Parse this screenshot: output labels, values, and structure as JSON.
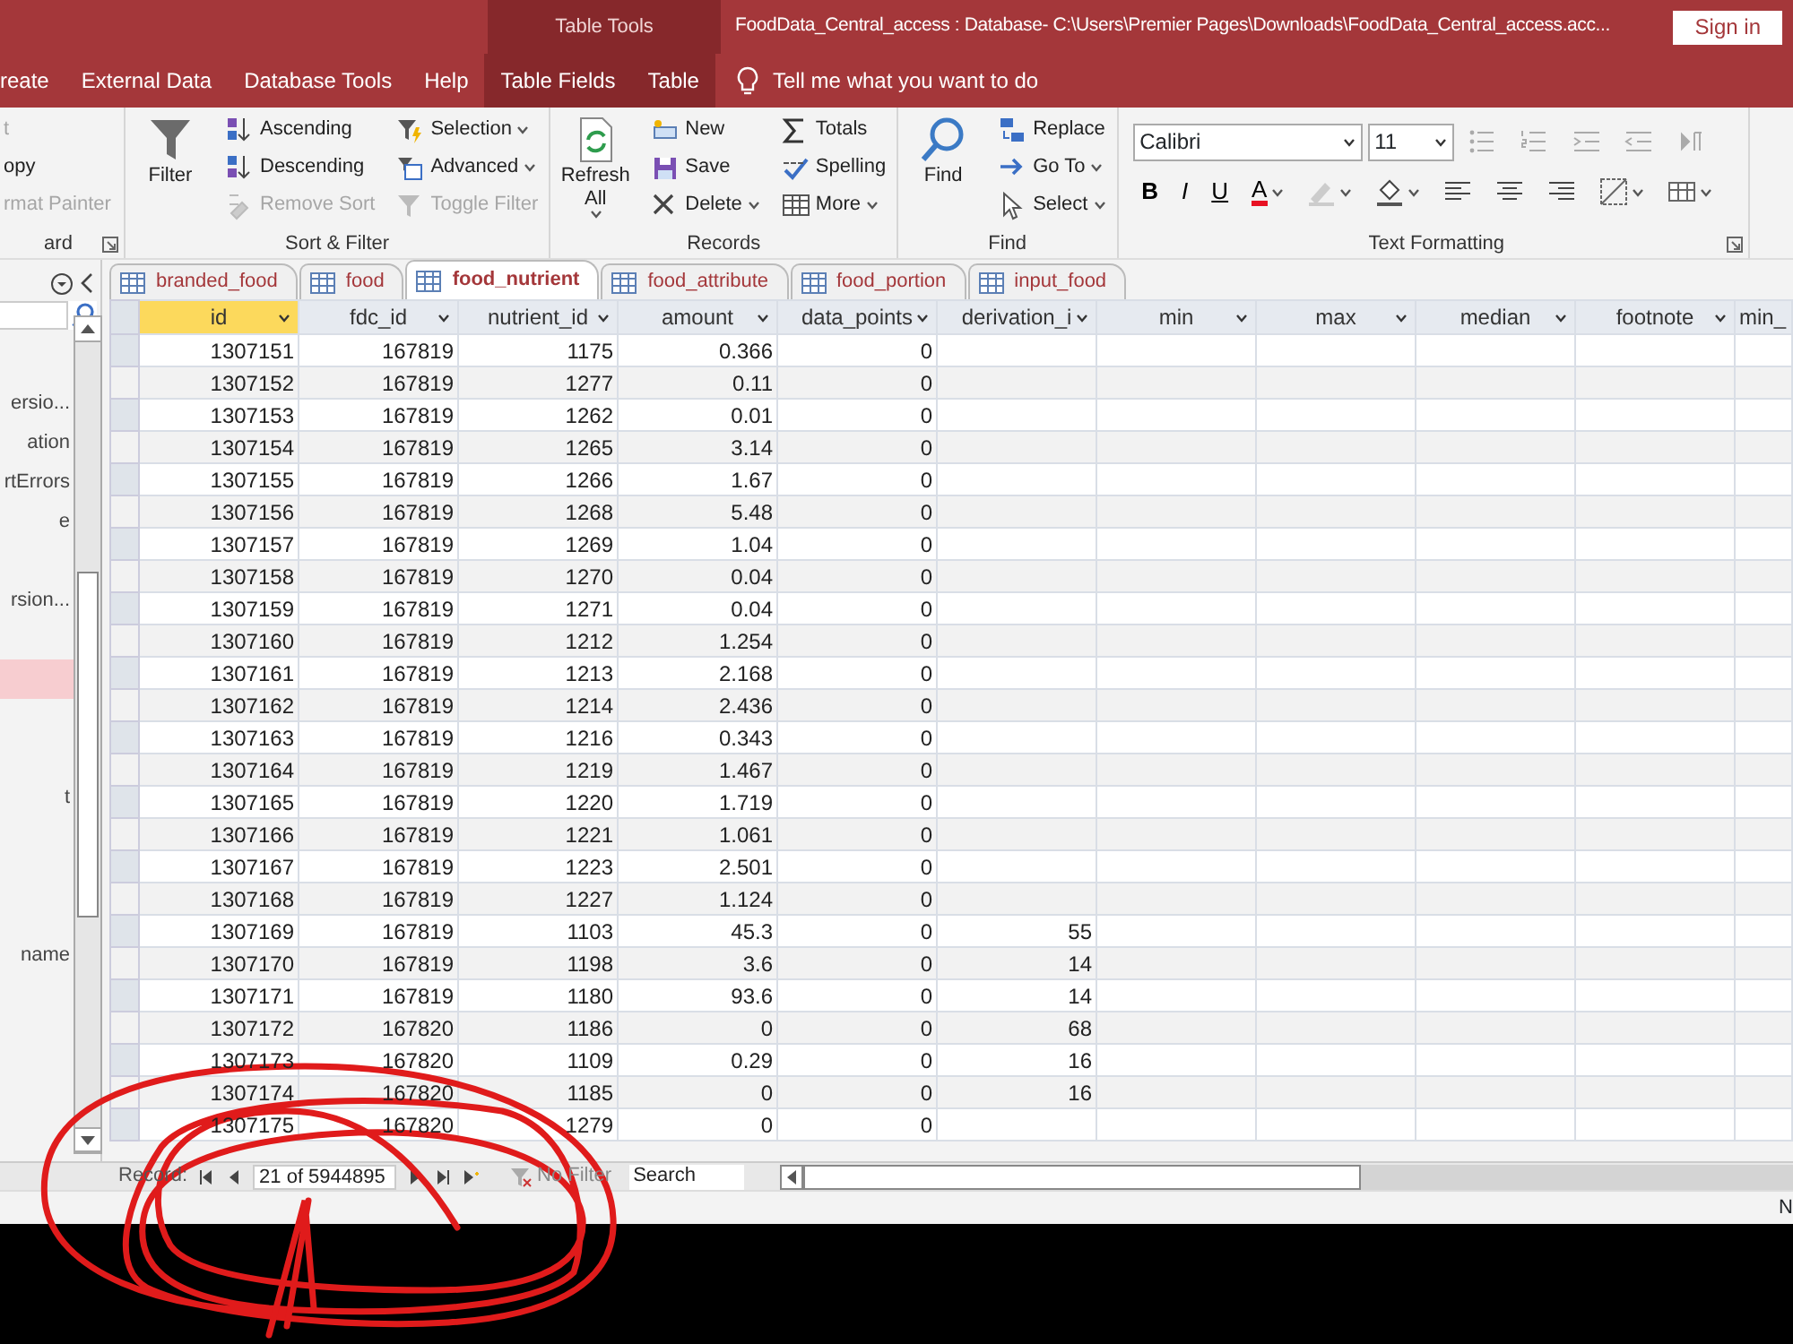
{
  "title_bar": {
    "context_label": "Table Tools",
    "title": "FoodData_Central_access : Database- C:\\Users\\Premier Pages\\Downloads\\FoodData_Central_access.acc...",
    "sign_in": "Sign in"
  },
  "ribbon_tabs": [
    {
      "label": "reate",
      "contextual": false
    },
    {
      "label": "External Data",
      "contextual": false
    },
    {
      "label": "Database Tools",
      "contextual": false
    },
    {
      "label": "Help",
      "contextual": false
    },
    {
      "label": "Table Fields",
      "contextual": true
    },
    {
      "label": "Table",
      "contextual": true
    }
  ],
  "tell_me": "Tell me what you want to do",
  "ribbon_groups": [
    {
      "label": "ard",
      "launcher": true,
      "columns": [
        [
          {
            "label": "t",
            "disabled": true,
            "dropdown": false
          },
          {
            "label": "opy",
            "disabled": false,
            "dropdown": false
          },
          {
            "label": "rmat Painter",
            "disabled": true,
            "dropdown": false
          }
        ]
      ]
    },
    {
      "label": "Sort & Filter",
      "launcher": false,
      "large": [
        {
          "label": "Filter",
          "dropdown": false
        }
      ],
      "columns": [
        [
          {
            "label": "Ascending",
            "disabled": false,
            "dropdown": false
          },
          {
            "label": "Descending",
            "disabled": false,
            "dropdown": false
          },
          {
            "label": "Remove Sort",
            "disabled": true,
            "dropdown": false
          }
        ],
        [
          {
            "label": "Selection",
            "disabled": false,
            "dropdown": true
          },
          {
            "label": "Advanced",
            "disabled": false,
            "dropdown": true
          },
          {
            "label": "Toggle Filter",
            "disabled": true,
            "dropdown": false
          }
        ]
      ]
    },
    {
      "label": "Records",
      "launcher": false,
      "large": [
        {
          "label": "Refresh All",
          "dropdown": true
        }
      ],
      "columns": [
        [
          {
            "label": "New",
            "disabled": false,
            "dropdown": false
          },
          {
            "label": "Save",
            "disabled": false,
            "dropdown": false
          },
          {
            "label": "Delete",
            "disabled": false,
            "dropdown": true
          }
        ],
        [
          {
            "label": "Totals",
            "disabled": false,
            "dropdown": false
          },
          {
            "label": "Spelling",
            "disabled": false,
            "dropdown": false
          },
          {
            "label": "More",
            "disabled": false,
            "dropdown": true
          }
        ]
      ]
    },
    {
      "label": "Find",
      "launcher": false,
      "large": [
        {
          "label": "Find",
          "dropdown": false
        }
      ],
      "columns": [
        [
          {
            "label": "Replace",
            "disabled": false,
            "dropdown": false
          },
          {
            "label": "Go To",
            "disabled": false,
            "dropdown": true
          },
          {
            "label": "Select",
            "disabled": false,
            "dropdown": true
          }
        ]
      ]
    }
  ],
  "text_formatting": {
    "label": "Text Formatting",
    "font": "Calibri",
    "size": "11",
    "style_buttons": [
      "B",
      "I",
      "U"
    ],
    "font_color_button": "A"
  },
  "nav_pane": {
    "items": [
      {
        "label": "ersio...",
        "selected": false
      },
      {
        "label": "ation",
        "selected": false
      },
      {
        "label": "rtErrors",
        "selected": false
      },
      {
        "label": "e",
        "selected": false
      },
      {
        "selected": false
      },
      {
        "label": "rsion...",
        "selected": false
      },
      {
        "selected": false
      },
      {
        "selected": true
      },
      {
        "selected": false
      },
      {
        "selected": false
      },
      {
        "label": "t",
        "selected": false
      },
      {
        "selected": false
      },
      {
        "selected": false
      },
      {
        "selected": false
      },
      {
        "label": "name",
        "selected": false
      }
    ]
  },
  "doc_tabs": [
    {
      "label": "branded_food",
      "selected": false
    },
    {
      "label": "food",
      "selected": false
    },
    {
      "label": "food_nutrient",
      "selected": true
    },
    {
      "label": "food_attribute",
      "selected": false
    },
    {
      "label": "food_portion",
      "selected": false
    },
    {
      "label": "input_food",
      "selected": false
    }
  ],
  "table": {
    "columns": [
      {
        "label": "id",
        "selected": true
      },
      {
        "label": "fdc_id",
        "selected": false
      },
      {
        "label": "nutrient_id",
        "selected": false
      },
      {
        "label": "amount",
        "selected": false
      },
      {
        "label": "data_points",
        "selected": false
      },
      {
        "label": "derivation_i",
        "selected": false
      },
      {
        "label": "min",
        "selected": false
      },
      {
        "label": "max",
        "selected": false
      },
      {
        "label": "median",
        "selected": false
      },
      {
        "label": "footnote",
        "selected": false
      },
      {
        "label": "min_",
        "selected": false
      }
    ],
    "rows": [
      [
        "1307151",
        "167819",
        "1175",
        "0.366",
        "0"
      ],
      [
        "1307152",
        "167819",
        "1277",
        "0.11",
        "0"
      ],
      [
        "1307153",
        "167819",
        "1262",
        "0.01",
        "0"
      ],
      [
        "1307154",
        "167819",
        "1265",
        "3.14",
        "0"
      ],
      [
        "1307155",
        "167819",
        "1266",
        "1.67",
        "0"
      ],
      [
        "1307156",
        "167819",
        "1268",
        "5.48",
        "0"
      ],
      [
        "1307157",
        "167819",
        "1269",
        "1.04",
        "0"
      ],
      [
        "1307158",
        "167819",
        "1270",
        "0.04",
        "0"
      ],
      [
        "1307159",
        "167819",
        "1271",
        "0.04",
        "0"
      ],
      [
        "1307160",
        "167819",
        "1212",
        "1.254",
        "0"
      ],
      [
        "1307161",
        "167819",
        "1213",
        "2.168",
        "0"
      ],
      [
        "1307162",
        "167819",
        "1214",
        "2.436",
        "0"
      ],
      [
        "1307163",
        "167819",
        "1216",
        "0.343",
        "0"
      ],
      [
        "1307164",
        "167819",
        "1219",
        "1.467",
        "0"
      ],
      [
        "1307165",
        "167819",
        "1220",
        "1.719",
        "0"
      ],
      [
        "1307166",
        "167819",
        "1221",
        "1.061",
        "0"
      ],
      [
        "1307167",
        "167819",
        "1223",
        "2.501",
        "0"
      ],
      [
        "1307168",
        "167819",
        "1227",
        "1.124",
        "0"
      ],
      [
        "1307169",
        "167819",
        "1103",
        "45.3",
        "0",
        "55"
      ],
      [
        "1307170",
        "167819",
        "1198",
        "3.6",
        "0",
        "14"
      ],
      [
        "1307171",
        "167819",
        "1180",
        "93.6",
        "0",
        "14"
      ],
      [
        "1307172",
        "167820",
        "1186",
        "0",
        "0",
        "68"
      ],
      [
        "1307173",
        "167820",
        "1109",
        "0.29",
        "0",
        "16"
      ],
      [
        "1307174",
        "167820",
        "1185",
        "0",
        "0",
        "16"
      ],
      [
        "1307175",
        "167820",
        "1279",
        "0",
        "0"
      ]
    ]
  },
  "record_nav": {
    "label": "Record:",
    "position": "21 of 5944895",
    "filter": "No Filter",
    "search_placeholder": "Search"
  },
  "status_text": "N"
}
